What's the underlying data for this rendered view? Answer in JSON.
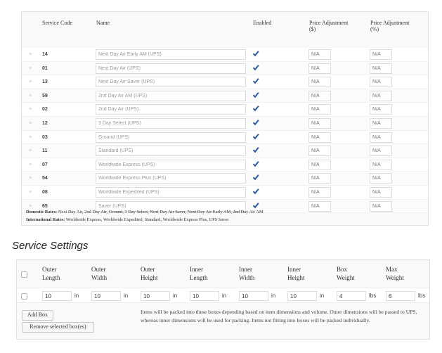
{
  "services_table": {
    "headers": {
      "code": "Service Code",
      "name": "Name",
      "enabled": "Enabled",
      "price_adj_dollar_line1": "Price Adjustment",
      "price_adj_dollar_line2": "($)",
      "price_adj_percent_line1": "Price Adjustment",
      "price_adj_percent_line2": "(%)"
    },
    "rows": [
      {
        "code": "14",
        "name": "Next Day Air Early AM (UPS)",
        "enabled": true,
        "adj_dollar": "N/A",
        "adj_percent": "N/A"
      },
      {
        "code": "01",
        "name": "Next Day Air (UPS)",
        "enabled": true,
        "adj_dollar": "N/A",
        "adj_percent": "N/A"
      },
      {
        "code": "13",
        "name": "Next Day Air Saver (UPS)",
        "enabled": true,
        "adj_dollar": "N/A",
        "adj_percent": "N/A"
      },
      {
        "code": "59",
        "name": "2nd Day Air AM (UPS)",
        "enabled": true,
        "adj_dollar": "N/A",
        "adj_percent": "N/A"
      },
      {
        "code": "02",
        "name": "2nd Day Air (UPS)",
        "enabled": true,
        "adj_dollar": "N/A",
        "adj_percent": "N/A"
      },
      {
        "code": "12",
        "name": "3 Day Select (UPS)",
        "enabled": true,
        "adj_dollar": "N/A",
        "adj_percent": "N/A"
      },
      {
        "code": "03",
        "name": "Ground (UPS)",
        "enabled": true,
        "adj_dollar": "N/A",
        "adj_percent": "N/A"
      },
      {
        "code": "11",
        "name": "Standard (UPS)",
        "enabled": true,
        "adj_dollar": "N/A",
        "adj_percent": "N/A"
      },
      {
        "code": "07",
        "name": "Worldwide Express (UPS)",
        "enabled": true,
        "adj_dollar": "N/A",
        "adj_percent": "N/A"
      },
      {
        "code": "54",
        "name": "Worldwide Express Plus (UPS)",
        "enabled": true,
        "adj_dollar": "N/A",
        "adj_percent": "N/A"
      },
      {
        "code": "08",
        "name": "Worldwide Expedited (UPS)",
        "enabled": true,
        "adj_dollar": "N/A",
        "adj_percent": "N/A"
      },
      {
        "code": "65",
        "name": "Saver (UPS)",
        "enabled": true,
        "adj_dollar": "N/A",
        "adj_percent": "N/A"
      }
    ],
    "domestic_label": "Domestic Rates:",
    "domestic_value": "Next Day Air, 2nd Day Air, Ground, 3 Day Select, Next Day Air Saver, Next Day Air Early AM, 2nd Day Air AM",
    "international_label": "International Rates:",
    "international_value": "Worldwide Express, Worldwide Expedited, Standard, Worldwide Express Plus, UPS Saver"
  },
  "service_settings": {
    "title": "Service Settings",
    "headers": [
      {
        "line1": "Outer",
        "line2": "Length"
      },
      {
        "line1": "Outer",
        "line2": "Width"
      },
      {
        "line1": "Outer",
        "line2": "Height"
      },
      {
        "line1": "Inner",
        "line2": "Length"
      },
      {
        "line1": "Inner",
        "line2": "Width"
      },
      {
        "line1": "Inner",
        "line2": "Height"
      },
      {
        "line1": "Box",
        "line2": "Weight"
      },
      {
        "line1": "Max",
        "line2": "Weight"
      }
    ],
    "row": [
      {
        "value": "10",
        "unit": "in"
      },
      {
        "value": "10",
        "unit": "in"
      },
      {
        "value": "10",
        "unit": "in"
      },
      {
        "value": "10",
        "unit": "in"
      },
      {
        "value": "10",
        "unit": "in"
      },
      {
        "value": "10",
        "unit": "in"
      },
      {
        "value": "4",
        "unit": "lbs"
      },
      {
        "value": "6",
        "unit": "lbs"
      }
    ],
    "add_box_label": "Add Box",
    "remove_box_label": "Remove selected box(es)",
    "note": "Items will be packed into these boxes depending based on item dimensions and volume. Outer dimensions will be passed to UPS, whereas inner dimensions will be used for packing. Items not fitting into boxes will be packed individually."
  },
  "colors": {
    "check": "#2a5d9f",
    "border": "#e1e1e1",
    "handle": "#c8c8c8"
  },
  "icons": {
    "drag_handle": "drag-handle-icon",
    "checkmark": "checkmark-icon"
  }
}
